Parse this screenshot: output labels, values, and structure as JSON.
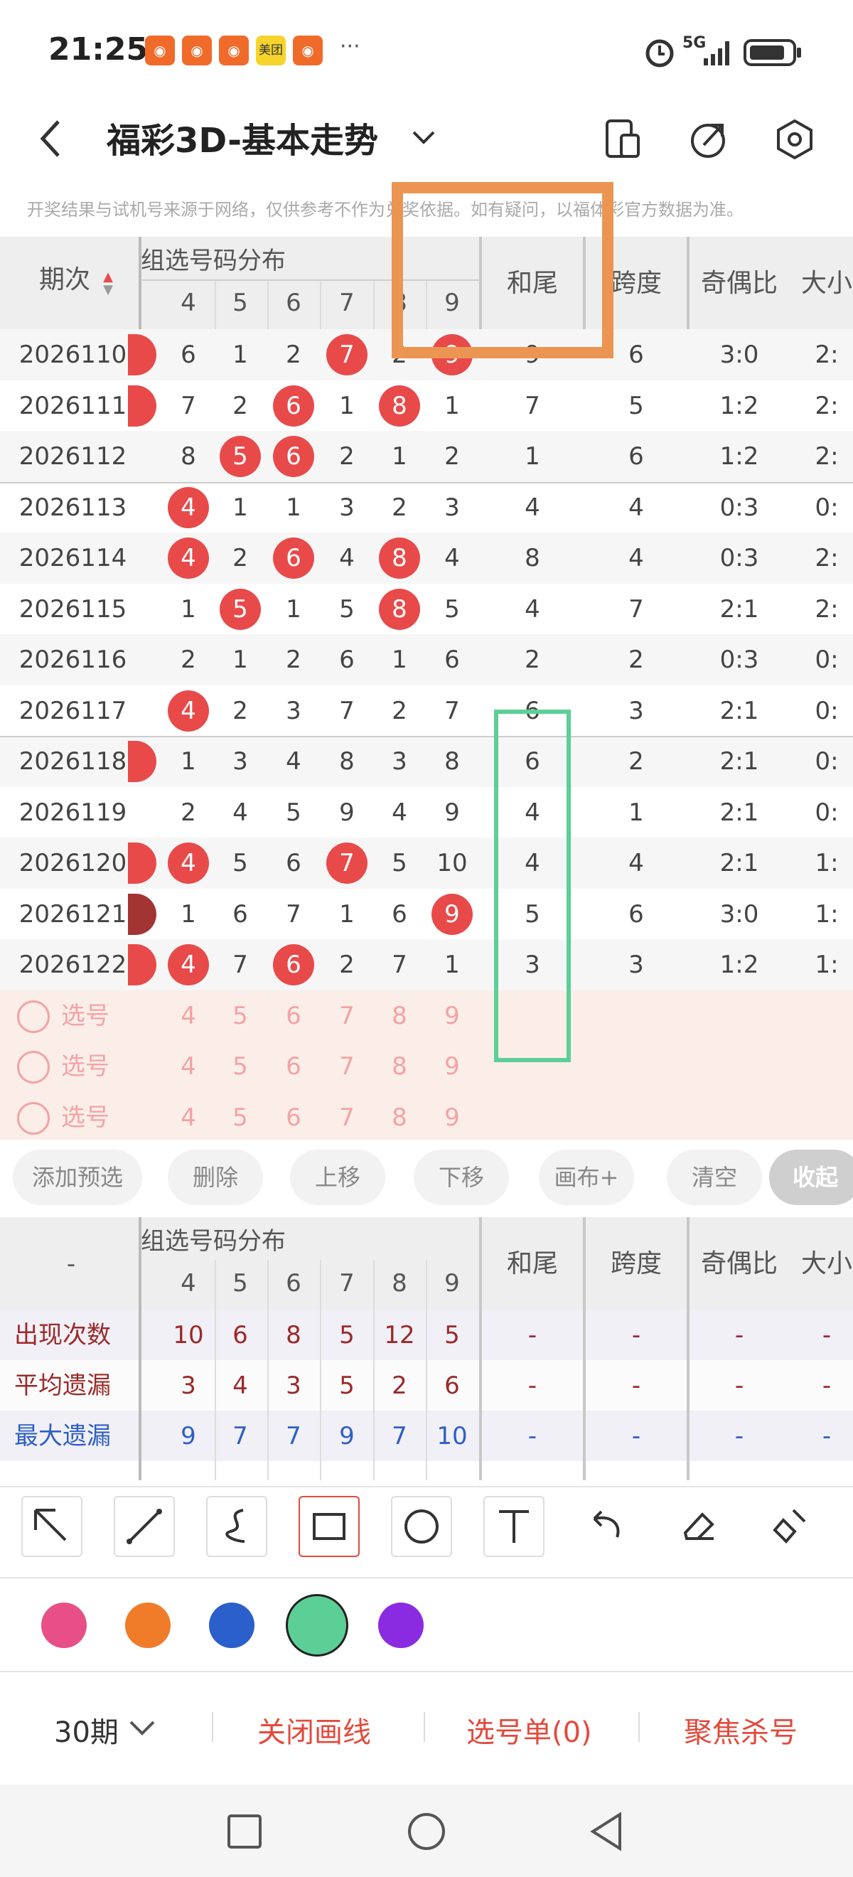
{
  "status": {
    "time": "21:25",
    "app_icons": [
      "app-icon",
      "app-icon",
      "app-icon",
      "美团",
      "app-icon"
    ],
    "more": "···",
    "network": "5G"
  },
  "header": {
    "title": "福彩3D-基本走势"
  },
  "notice": "开奖结果与试机号来源于网络，仅供参考不作为兑奖依据。如有疑问，以福体彩官方数据为准。",
  "table": {
    "period_header": "期次",
    "dist_header": "组选号码分布",
    "digits": [
      "4",
      "5",
      "6",
      "7",
      "8",
      "9"
    ],
    "columns": [
      "和尾",
      "跨度",
      "奇偶比",
      "大小"
    ],
    "rows": [
      {
        "period": "2026110",
        "cells": [
          "6",
          "1",
          "2",
          "7",
          "2",
          "9"
        ],
        "hit": [
          3,
          5
        ],
        "hewei": "9",
        "kuadu": "6",
        "jiou": "3:0",
        "daxiao": "2:"
      },
      {
        "period": "2026111",
        "cells": [
          "7",
          "2",
          "6",
          "1",
          "8",
          "1"
        ],
        "hit": [
          2,
          4
        ],
        "hewei": "7",
        "kuadu": "5",
        "jiou": "1:2",
        "daxiao": "2:"
      },
      {
        "period": "2026112",
        "cells": [
          "8",
          "5",
          "6",
          "2",
          "1",
          "2"
        ],
        "hit": [
          1,
          2
        ],
        "hewei": "1",
        "kuadu": "6",
        "jiou": "1:2",
        "daxiao": "2:"
      },
      {
        "period": "2026113",
        "cells": [
          "4",
          "1",
          "1",
          "3",
          "2",
          "3"
        ],
        "hit": [
          0
        ],
        "hewei": "4",
        "kuadu": "4",
        "jiou": "0:3",
        "daxiao": "0:"
      },
      {
        "period": "2026114",
        "cells": [
          "4",
          "2",
          "6",
          "4",
          "8",
          "4"
        ],
        "hit": [
          0,
          2,
          4
        ],
        "hewei": "8",
        "kuadu": "4",
        "jiou": "0:3",
        "daxiao": "2:"
      },
      {
        "period": "2026115",
        "cells": [
          "1",
          "5",
          "1",
          "5",
          "8",
          "5"
        ],
        "hit": [
          1,
          4
        ],
        "hewei": "4",
        "kuadu": "7",
        "jiou": "2:1",
        "daxiao": "2:"
      },
      {
        "period": "2026116",
        "cells": [
          "2",
          "1",
          "2",
          "6",
          "1",
          "6"
        ],
        "hit": [],
        "hewei": "2",
        "kuadu": "2",
        "jiou": "0:3",
        "daxiao": "0:"
      },
      {
        "period": "2026117",
        "cells": [
          "4",
          "2",
          "3",
          "7",
          "2",
          "7"
        ],
        "hit": [
          0
        ],
        "hewei": "6",
        "kuadu": "3",
        "jiou": "2:1",
        "daxiao": "0:"
      },
      {
        "period": "2026118",
        "cells": [
          "1",
          "3",
          "4",
          "8",
          "3",
          "8"
        ],
        "hit": [],
        "hewei": "6",
        "kuadu": "2",
        "jiou": "2:1",
        "daxiao": "0:"
      },
      {
        "period": "2026119",
        "cells": [
          "2",
          "4",
          "5",
          "9",
          "4",
          "9"
        ],
        "hit": [],
        "hewei": "4",
        "kuadu": "1",
        "jiou": "2:1",
        "daxiao": "0:"
      },
      {
        "period": "2026120",
        "cells": [
          "4",
          "5",
          "6",
          "7",
          "5",
          "10"
        ],
        "hit": [
          0,
          3
        ],
        "hewei": "4",
        "kuadu": "4",
        "jiou": "2:1",
        "daxiao": "1:"
      },
      {
        "period": "2026121",
        "cells": [
          "1",
          "6",
          "7",
          "1",
          "6",
          "9"
        ],
        "hit": [
          5
        ],
        "hewei": "5",
        "kuadu": "6",
        "jiou": "3:0",
        "daxiao": "1:"
      },
      {
        "period": "2026122",
        "cells": [
          "4",
          "7",
          "6",
          "2",
          "7",
          "1"
        ],
        "hit": [
          0,
          2
        ],
        "hewei": "3",
        "kuadu": "3",
        "jiou": "1:2",
        "daxiao": "1:"
      }
    ],
    "pick_label": "选号",
    "pick_count": 3
  },
  "actions": [
    "添加预选",
    "删除",
    "上移",
    "下移",
    "画布+",
    "清空",
    "收起"
  ],
  "stats": {
    "first_header": "-",
    "rows": [
      {
        "label": "出现次数",
        "values": [
          "10",
          "6",
          "8",
          "5",
          "12",
          "5"
        ],
        "color": "#9b2a2a"
      },
      {
        "label": "平均遗漏",
        "values": [
          "3",
          "4",
          "3",
          "5",
          "2",
          "6"
        ],
        "color": "#9b2a2a"
      },
      {
        "label": "最大遗漏",
        "values": [
          "9",
          "7",
          "7",
          "9",
          "7",
          "10"
        ],
        "color": "#2f5fc4"
      }
    ],
    "dash": "-"
  },
  "tools": [
    "arrow-tool-icon",
    "line-tool-icon",
    "freehand-tool-icon",
    "rect-tool-icon",
    "circle-tool-icon",
    "text-tool-icon",
    "undo-icon",
    "eraser-icon",
    "clear-brush-icon"
  ],
  "palette": [
    "#e84f86",
    "#f07b29",
    "#2a5fcc",
    "#5ccf96",
    "#8a2be2"
  ],
  "bottom": {
    "period_select": "30期",
    "close_draw": "关闭画线",
    "pick_list": "选号单(0)",
    "focus_kill": "聚焦杀号"
  }
}
